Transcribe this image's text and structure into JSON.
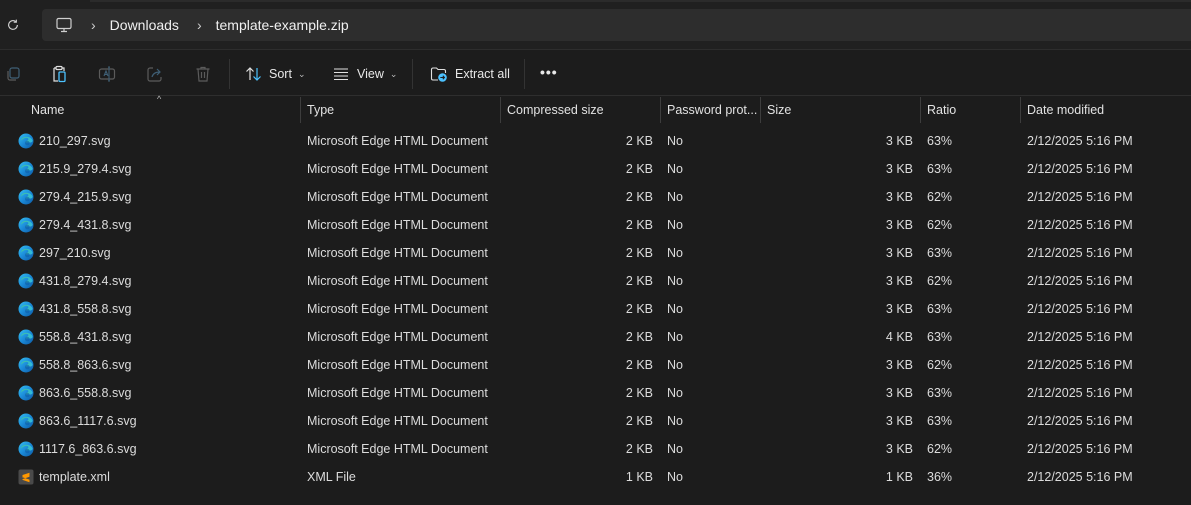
{
  "address_bar": {
    "root_icon": "pc-icon",
    "breadcrumbs": [
      "Downloads",
      "template-example.zip"
    ]
  },
  "toolbar": {
    "icons": [
      "copy-icon",
      "paste-icon",
      "rename-icon",
      "share-icon",
      "delete-icon"
    ],
    "sort_label": "Sort",
    "view_label": "View",
    "extract_label": "Extract all",
    "more_label": "•••"
  },
  "columns": {
    "name": "Name",
    "type": "Type",
    "compressed": "Compressed size",
    "password": "Password prot...",
    "size": "Size",
    "ratio": "Ratio",
    "date": "Date modified"
  },
  "files": [
    {
      "name": "210_297.svg",
      "icon": "edge-icon",
      "type": "Microsoft Edge HTML Document",
      "compressed": "2 KB",
      "password": "No",
      "size": "3 KB",
      "ratio": "63%",
      "date": "2/12/2025 5:16 PM"
    },
    {
      "name": "215.9_279.4.svg",
      "icon": "edge-icon",
      "type": "Microsoft Edge HTML Document",
      "compressed": "2 KB",
      "password": "No",
      "size": "3 KB",
      "ratio": "63%",
      "date": "2/12/2025 5:16 PM"
    },
    {
      "name": "279.4_215.9.svg",
      "icon": "edge-icon",
      "type": "Microsoft Edge HTML Document",
      "compressed": "2 KB",
      "password": "No",
      "size": "3 KB",
      "ratio": "62%",
      "date": "2/12/2025 5:16 PM"
    },
    {
      "name": "279.4_431.8.svg",
      "icon": "edge-icon",
      "type": "Microsoft Edge HTML Document",
      "compressed": "2 KB",
      "password": "No",
      "size": "3 KB",
      "ratio": "62%",
      "date": "2/12/2025 5:16 PM"
    },
    {
      "name": "297_210.svg",
      "icon": "edge-icon",
      "type": "Microsoft Edge HTML Document",
      "compressed": "2 KB",
      "password": "No",
      "size": "3 KB",
      "ratio": "63%",
      "date": "2/12/2025 5:16 PM"
    },
    {
      "name": "431.8_279.4.svg",
      "icon": "edge-icon",
      "type": "Microsoft Edge HTML Document",
      "compressed": "2 KB",
      "password": "No",
      "size": "3 KB",
      "ratio": "62%",
      "date": "2/12/2025 5:16 PM"
    },
    {
      "name": "431.8_558.8.svg",
      "icon": "edge-icon",
      "type": "Microsoft Edge HTML Document",
      "compressed": "2 KB",
      "password": "No",
      "size": "3 KB",
      "ratio": "63%",
      "date": "2/12/2025 5:16 PM"
    },
    {
      "name": "558.8_431.8.svg",
      "icon": "edge-icon",
      "type": "Microsoft Edge HTML Document",
      "compressed": "2 KB",
      "password": "No",
      "size": "4 KB",
      "ratio": "63%",
      "date": "2/12/2025 5:16 PM"
    },
    {
      "name": "558.8_863.6.svg",
      "icon": "edge-icon",
      "type": "Microsoft Edge HTML Document",
      "compressed": "2 KB",
      "password": "No",
      "size": "3 KB",
      "ratio": "62%",
      "date": "2/12/2025 5:16 PM"
    },
    {
      "name": "863.6_558.8.svg",
      "icon": "edge-icon",
      "type": "Microsoft Edge HTML Document",
      "compressed": "2 KB",
      "password": "No",
      "size": "3 KB",
      "ratio": "63%",
      "date": "2/12/2025 5:16 PM"
    },
    {
      "name": "863.6_1117.6.svg",
      "icon": "edge-icon",
      "type": "Microsoft Edge HTML Document",
      "compressed": "2 KB",
      "password": "No",
      "size": "3 KB",
      "ratio": "63%",
      "date": "2/12/2025 5:16 PM"
    },
    {
      "name": "1117.6_863.6.svg",
      "icon": "edge-icon",
      "type": "Microsoft Edge HTML Document",
      "compressed": "2 KB",
      "password": "No",
      "size": "3 KB",
      "ratio": "62%",
      "date": "2/12/2025 5:16 PM"
    },
    {
      "name": "template.xml",
      "icon": "sublime-xml-icon",
      "type": "XML File",
      "compressed": "1 KB",
      "password": "No",
      "size": "1 KB",
      "ratio": "36%",
      "date": "2/12/2025 5:16 PM"
    }
  ],
  "colors": {
    "accent": "#4cc2ff",
    "background": "#1c1c1c",
    "address_bg": "#2d2d2d"
  }
}
